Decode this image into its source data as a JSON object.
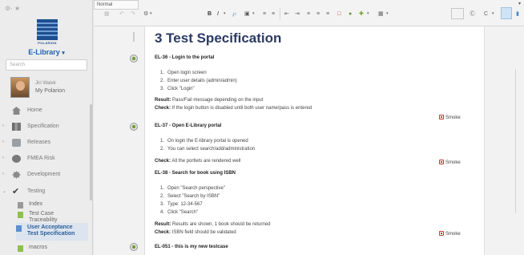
{
  "sidebar": {
    "top_icons": "⚙· ★",
    "logo_text": "POLARION",
    "library_title": "E-Library",
    "library_caret": "▾",
    "search_placeholder": "Search",
    "user_name": "Jiri Walek",
    "project_name": "My Polarion",
    "nav": [
      {
        "label": "Home",
        "icon": "home-icon"
      },
      {
        "label": "Specification",
        "icon": "specification-icon"
      },
      {
        "label": "Releases",
        "icon": "releases-icon"
      },
      {
        "label": "FMEA Risk",
        "icon": "fmea-risk-icon"
      },
      {
        "label": "Development",
        "icon": "gear-icon"
      },
      {
        "label": "Testing",
        "icon": "check-icon"
      }
    ],
    "testing_children": [
      {
        "label": "Index"
      },
      {
        "label": "Test Case",
        "label2": "Traceability"
      },
      {
        "label": "User Acceptance",
        "label2": "Test Specification"
      },
      {
        "label": "macros"
      }
    ],
    "expander_glyph": "›",
    "expanded_glyph": "⌄"
  },
  "toolbar": {
    "undo": "↶",
    "redo": "↷",
    "settings": "⚙",
    "style_select": "Normal",
    "bold": "B",
    "italic": "I",
    "dropdown": "▾",
    "sidebar_glyph": "□",
    "history_glyph": "Ⓒ",
    "refresh_glyph": "C"
  },
  "document": {
    "heading": "3 Test Specification",
    "testcases": [
      {
        "title": "EL-36 - Login to the portal",
        "steps": [
          "Open login screen",
          "Enter user details (admin/admin)",
          "Click \"Login\""
        ],
        "result_label": "Result:",
        "result": "Pass/Fail message depending on the input",
        "check_label": "Check:",
        "check": "If the login button is disabled until both user name/pass is entered",
        "tag": "Smoke"
      },
      {
        "title": "EL-37 - Open E-Library portal",
        "steps": [
          "On login the E-library portal is opened",
          "You can select search/add/administration"
        ],
        "check_label": "Check:",
        "check": "All the portlets are rendered well",
        "tag": "Smoke"
      },
      {
        "title": "EL-38 - Search for book using ISBN",
        "steps": [
          "Open \"Search perspective\"",
          "Select \"Search by ISBN\"",
          "Type: 12-34-567",
          "Click \"Search\""
        ],
        "result_label": "Result:",
        "result": "Results are shown, 1 book should be returned",
        "check_label": "Check:",
        "check": "ISBN field should be validated",
        "tag": "Smoke"
      },
      {
        "title": "EL-051 - this is my new testcase"
      }
    ]
  }
}
